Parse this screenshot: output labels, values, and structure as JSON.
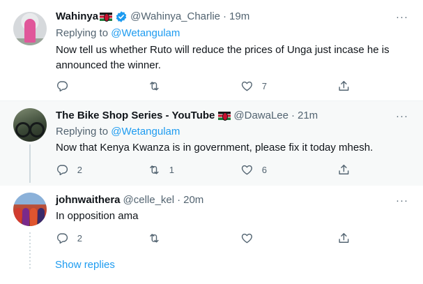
{
  "colors": {
    "link": "#1d9bf0",
    "muted": "#536471",
    "text": "#0f1419",
    "hover_bg": "#f7f9f9"
  },
  "tweets": [
    {
      "name": "Wahinya",
      "flag_icon": "kenya-flag-icon",
      "verified_icon": "verified-badge-icon",
      "handle": "@Wahinya_Charlie",
      "separator": "·",
      "time": "19m",
      "replying_label": "Replying to",
      "replying_mention": "@Wetangulam",
      "text": "Now tell us whether Ruto will reduce the prices of Unga just incase he is announced the winner.",
      "reply_count": "",
      "retweet_count": "",
      "like_count": "7"
    },
    {
      "name": "The Bike Shop Series - YouTube",
      "flag_icon": "kenya-flag-icon",
      "handle": "@DawaLee",
      "separator": "·",
      "time": "21m",
      "replying_label": "Replying to",
      "replying_mention": "@Wetangulam",
      "text": "Now that Kenya Kwanza is in government, please fix it today mhesh.",
      "reply_count": "2",
      "retweet_count": "1",
      "like_count": "6"
    },
    {
      "name": "johnwaithera",
      "handle": "@celle_kel",
      "separator": "·",
      "time": "20m",
      "text": "In opposition ama",
      "reply_count": "2",
      "retweet_count": "",
      "like_count": ""
    }
  ],
  "more_label": "···",
  "show_replies": "Show replies"
}
